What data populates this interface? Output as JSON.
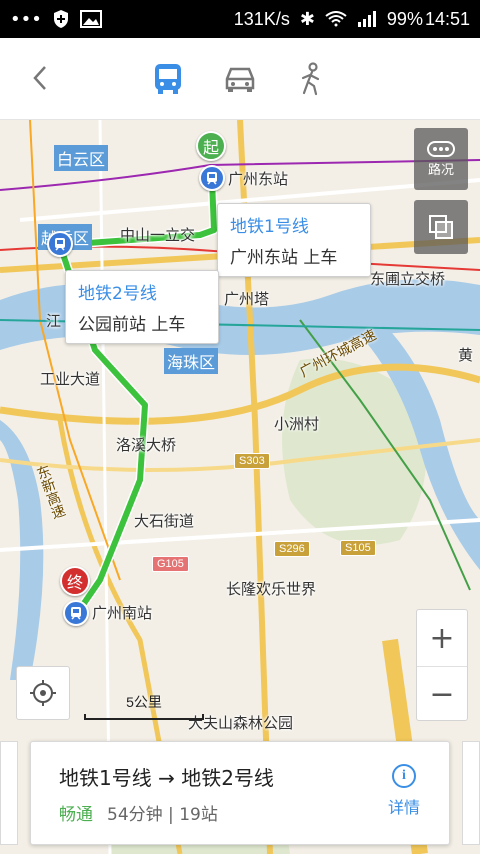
{
  "status_bar": {
    "network_speed": "131K/s",
    "battery": "99%",
    "time": "14:51"
  },
  "nav": {
    "modes": [
      {
        "name": "bus-icon",
        "active": true
      },
      {
        "name": "car-icon",
        "active": false
      },
      {
        "name": "walk-icon",
        "active": false
      }
    ],
    "active_color": "#3a8ee6"
  },
  "map": {
    "markers": {
      "start": "起",
      "end": "终"
    },
    "callouts": [
      {
        "line": "地铁1号线",
        "stop": "广州东站 上车"
      },
      {
        "line": "地铁2号线",
        "stop": "公园前站 上车"
      }
    ],
    "districts": {
      "baiyun": "白云区",
      "yuexiu": "越秀区",
      "haizhu": "海珠区"
    },
    "places": {
      "guangzhou_east": "广州东站",
      "zhongshan": "中山一立交",
      "guangzhou_tower": "广州塔",
      "dongpu_bridge": "东圃立交桥",
      "jiang": "江",
      "gongye": "工业大道",
      "xiaozhou": "小洲村",
      "luoxi": "洛溪大桥",
      "dashi": "大石街道",
      "guangzhou_south": "广州南站",
      "changlong": "长隆欢乐世界",
      "dafushan": "大夫山森林公园",
      "huangpu": "黄"
    },
    "roads": {
      "ring": "广州环城高速",
      "dongxin": "东新高速"
    },
    "shields": [
      "S303",
      "S296",
      "S105",
      "G105"
    ],
    "traffic_label": "路况",
    "zoom_in": "+",
    "zoom_out": "−",
    "scale_text": "5公里"
  },
  "route_card": {
    "route": "地铁1号线 → 地铁2号线",
    "status": "畅通",
    "duration": "54分钟",
    "stations": "19站",
    "detail_label": "详情"
  }
}
